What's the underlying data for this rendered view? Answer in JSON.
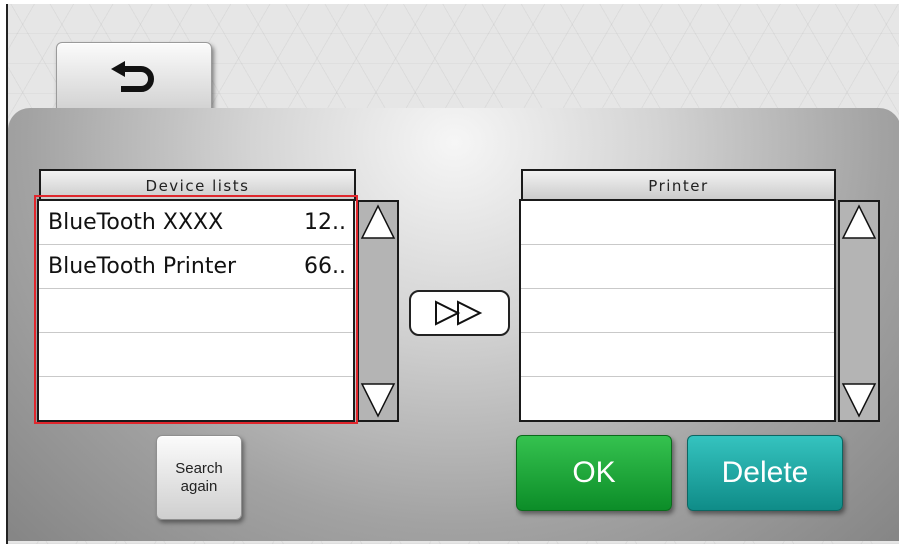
{
  "back_button": {
    "icon": "return-arrow-icon"
  },
  "device_list": {
    "header": "Device lists",
    "rows": [
      {
        "name": "BlueTooth XXXX",
        "address": "12.."
      },
      {
        "name": "BlueTooth Printer",
        "address": "66.."
      },
      {
        "name": "",
        "address": ""
      },
      {
        "name": "",
        "address": ""
      },
      {
        "name": "",
        "address": ""
      }
    ],
    "highlight_color": "#e0262c"
  },
  "printer_list": {
    "header": "Printer",
    "rows": [
      "",
      "",
      "",
      "",
      ""
    ]
  },
  "transfer_button": {
    "icon": "double-triangle-right-icon"
  },
  "search_button": {
    "label": "Search\nagain"
  },
  "ok_button": {
    "label": "OK",
    "color": "#1aa83a"
  },
  "delete_button": {
    "label": "Delete",
    "color": "#1fa9a5"
  }
}
